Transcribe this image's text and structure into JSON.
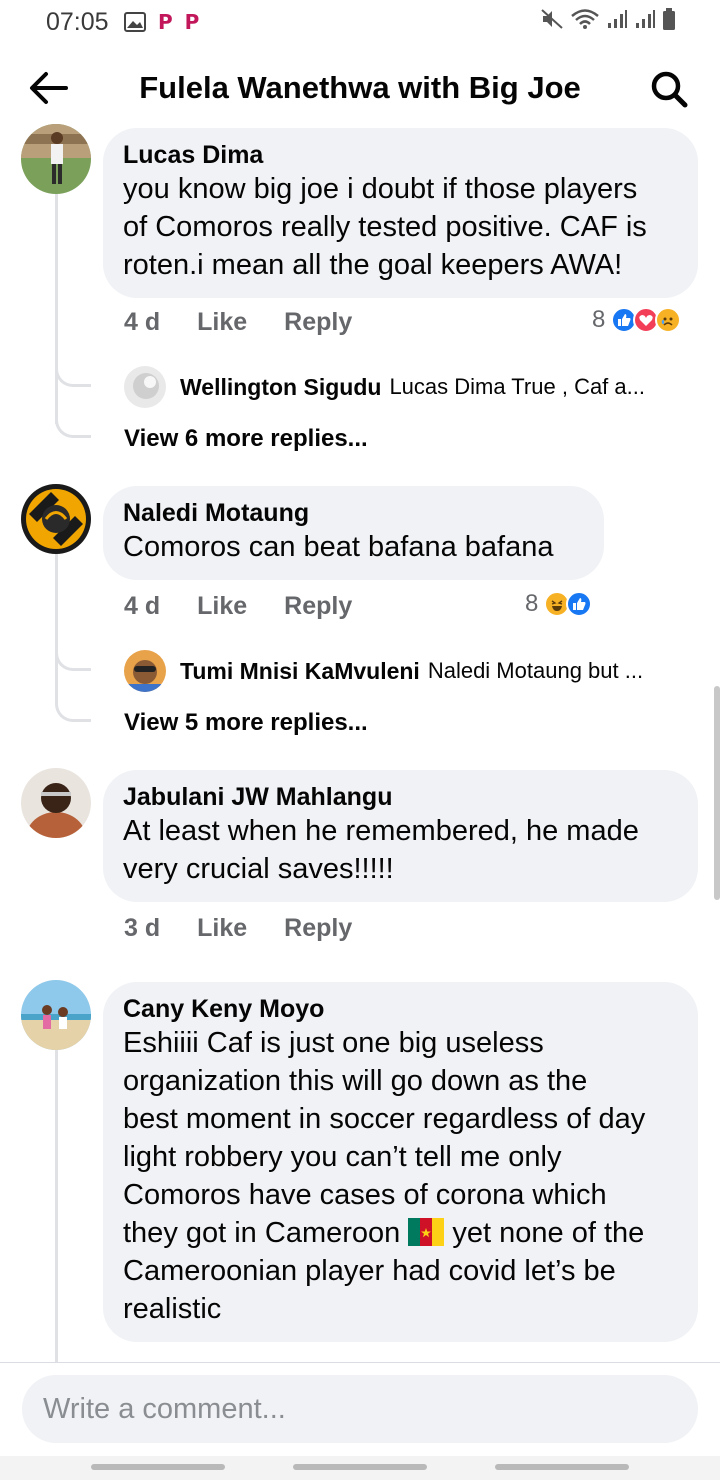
{
  "status_bar": {
    "time": "07:05"
  },
  "header": {
    "title": "Fulela Wanethwa with Big Joe"
  },
  "comments": [
    {
      "author": "Lucas Dima",
      "lines": [
        "you know big joe i doubt if those players",
        "of Comoros really tested positive. CAF is",
        "roten.i mean all the goal keepers AWA!"
      ],
      "time": "4 d",
      "like_label": "Like",
      "reply_label": "Reply",
      "reaction_count": "8",
      "reactions": [
        "like",
        "love",
        "sad"
      ],
      "reply_preview": {
        "author": "Wellington Sigudu",
        "text": "Lucas Dima True , Caf a..."
      },
      "view_more": "View 6 more replies..."
    },
    {
      "author": "Naledi Motaung",
      "lines": [
        "Comoros can beat bafana bafana"
      ],
      "time": "4 d",
      "like_label": "Like",
      "reply_label": "Reply",
      "reaction_count": "8",
      "reactions": [
        "haha",
        "like"
      ],
      "reply_preview": {
        "author": "Tumi Mnisi KaMvuleni",
        "text": "Naledi Motaung but ..."
      },
      "view_more": "View 5 more replies..."
    },
    {
      "author": "Jabulani JW Mahlangu",
      "lines": [
        "At least when he remembered, he made",
        "very crucial saves!!!!!"
      ],
      "time": "3 d",
      "like_label": "Like",
      "reply_label": "Reply"
    },
    {
      "author": "Cany Keny Moyo",
      "lines": [
        "Eshiiii Caf is just one big useless",
        "organization this will go down as the",
        "best moment in soccer regardless of day",
        "light robbery you can’t tell me only",
        "Comoros have cases of corona which",
        "yet none of the",
        "Cameroonian player had covid let’s be",
        "realistic"
      ],
      "line6_prefix": "they got in Cameroon",
      "flag": "cameroon-flag"
    }
  ],
  "composer": {
    "placeholder": "Write a comment..."
  },
  "colors": {
    "bubble": "#f0f2f5",
    "like_blue": "#1877f2",
    "love_red": "#f33e58",
    "emoji_yellow": "#f7b125"
  }
}
